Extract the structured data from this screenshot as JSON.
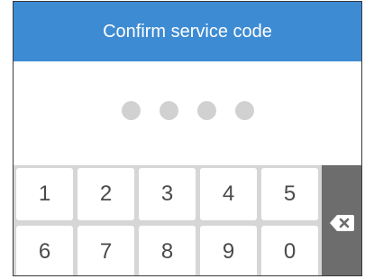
{
  "dialog": {
    "title": "Confirm service code"
  },
  "pin": {
    "length": 4,
    "entered": 0
  },
  "keypad": {
    "keys": [
      "1",
      "2",
      "3",
      "4",
      "5",
      "6",
      "7",
      "8",
      "9",
      "0"
    ],
    "backspace_icon": "backspace-icon"
  },
  "colors": {
    "title_bar": "#3d8bd3",
    "pin_dot": "#d1d1d1",
    "backspace_key": "#6d6d6d",
    "keypad_background": "#d6d6d6"
  }
}
